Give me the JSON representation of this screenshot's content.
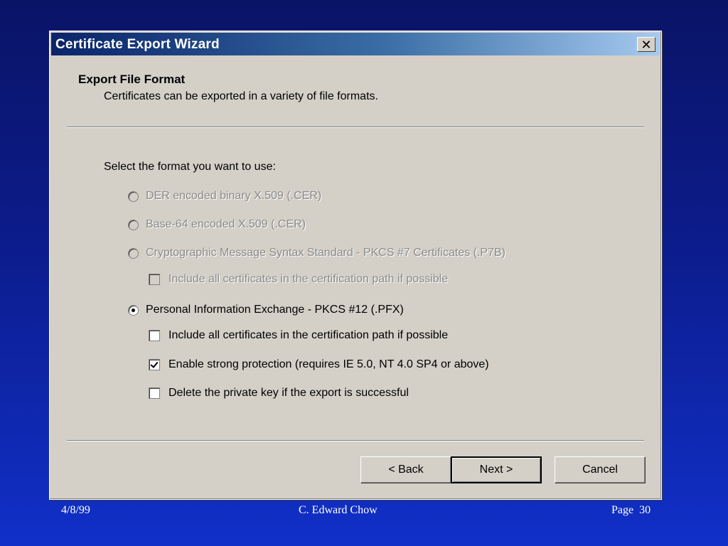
{
  "window": {
    "title": "Certificate Export Wizard",
    "close_label": "✕"
  },
  "header": {
    "title": "Export File Format",
    "subtitle": "Certificates can be exported in a variety of file formats."
  },
  "prompt": "Select the format you want to use:",
  "options": [
    {
      "label": "DER encoded binary X.509 (.CER)",
      "selected": false,
      "enabled": false
    },
    {
      "label": "Base-64 encoded X.509 (.CER)",
      "selected": false,
      "enabled": false
    },
    {
      "label": "Cryptographic Message Syntax Standard - PKCS #7 Certificates (.P7B)",
      "selected": false,
      "enabled": false
    },
    {
      "label": "Personal Information Exchange - PKCS #12 (.PFX)",
      "selected": true,
      "enabled": true
    }
  ],
  "checkboxes": [
    {
      "label": "Include all certificates in the certification path if possible",
      "checked": false,
      "enabled": false
    },
    {
      "label": "Include all certificates in the certification path if possible",
      "checked": false,
      "enabled": true
    },
    {
      "label": "Enable strong protection (requires IE 5.0, NT 4.0 SP4 or above)",
      "checked": true,
      "enabled": true
    },
    {
      "label": "Delete the private key if the export is successful",
      "checked": false,
      "enabled": true
    }
  ],
  "buttons": {
    "back": "< Back",
    "next": "Next >",
    "cancel": "Cancel"
  },
  "footer": {
    "date": "4/8/99",
    "author": "C. Edward Chow",
    "page": "Page  30"
  }
}
